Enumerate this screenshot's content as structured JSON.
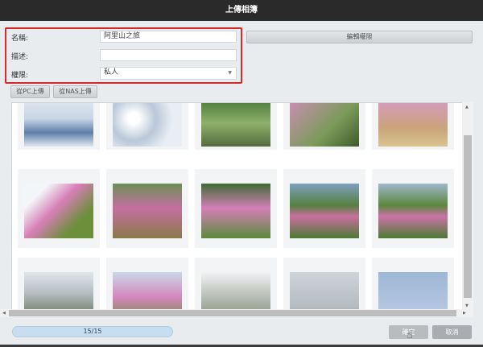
{
  "window": {
    "title": "上傳相簿"
  },
  "form": {
    "name_label": "名稱:",
    "name_value": "阿里山之旅",
    "desc_label": "描述:",
    "desc_value": "",
    "perm_label": "權限:",
    "perm_value": "私人"
  },
  "buttons": {
    "edit_permissions": "編輯權限",
    "upload_pc": "從PC上傳",
    "upload_nas": "從NAS上傳",
    "confirm": "確定",
    "cancel": "取消"
  },
  "progress": {
    "text": "15/15",
    "fraction": 1.0
  },
  "photos": [
    {
      "c": "linear-gradient(#dfe6ee 0%,#c8d6e6 40%,#5f7fa8 70%,#dfe7f0 100%)"
    },
    {
      "c": "radial-gradient(circle at 30% 40%,#fff 10%,#b9c7d8 40%,#e9eef4 70%)"
    },
    {
      "c": "linear-gradient(#4d7a3a,#8db06a 50%,#556b3d)"
    },
    {
      "c": "linear-gradient(135deg,#c98fb5,#7a9a58 60%,#3d5a2c)"
    },
    {
      "c": "linear-gradient(#d59ac0,#c9a37a 60%,#d9c48f)"
    },
    {
      "c": "linear-gradient(135deg,#f3f6f8 20%,#d77fb7 45%,#6b8f3a 75%)"
    },
    {
      "c": "linear-gradient(#6c8f55,#c46fa0 45%,#8a7a4a)"
    },
    {
      "c": "linear-gradient(#3f6b34,#d57fb8 45%,#5a8a3b)"
    },
    {
      "c": "linear-gradient(#7ea0bf,#56803f 40%,#c86f9e 60%,#4c7a33)"
    },
    {
      "c": "linear-gradient(#9fb7cc,#5b873d 40%,#cc73a8 60%,#4b7a33)"
    },
    {
      "c": "linear-gradient(#e0e5ea,#b7c0c6 40%,#5b6b4a)"
    },
    {
      "c": "linear-gradient(#c9d8ea,#d486be 50%,#6d8c43)"
    },
    {
      "c": "linear-gradient(#f0f2f3,#b8bdb5 50%,#7b8a74)"
    },
    {
      "c": "linear-gradient(#cfd4d8,#b4bcc2 70%,#6b7b84)"
    },
    {
      "c": "linear-gradient(#9eb7d6,#b9cbe3)"
    }
  ]
}
